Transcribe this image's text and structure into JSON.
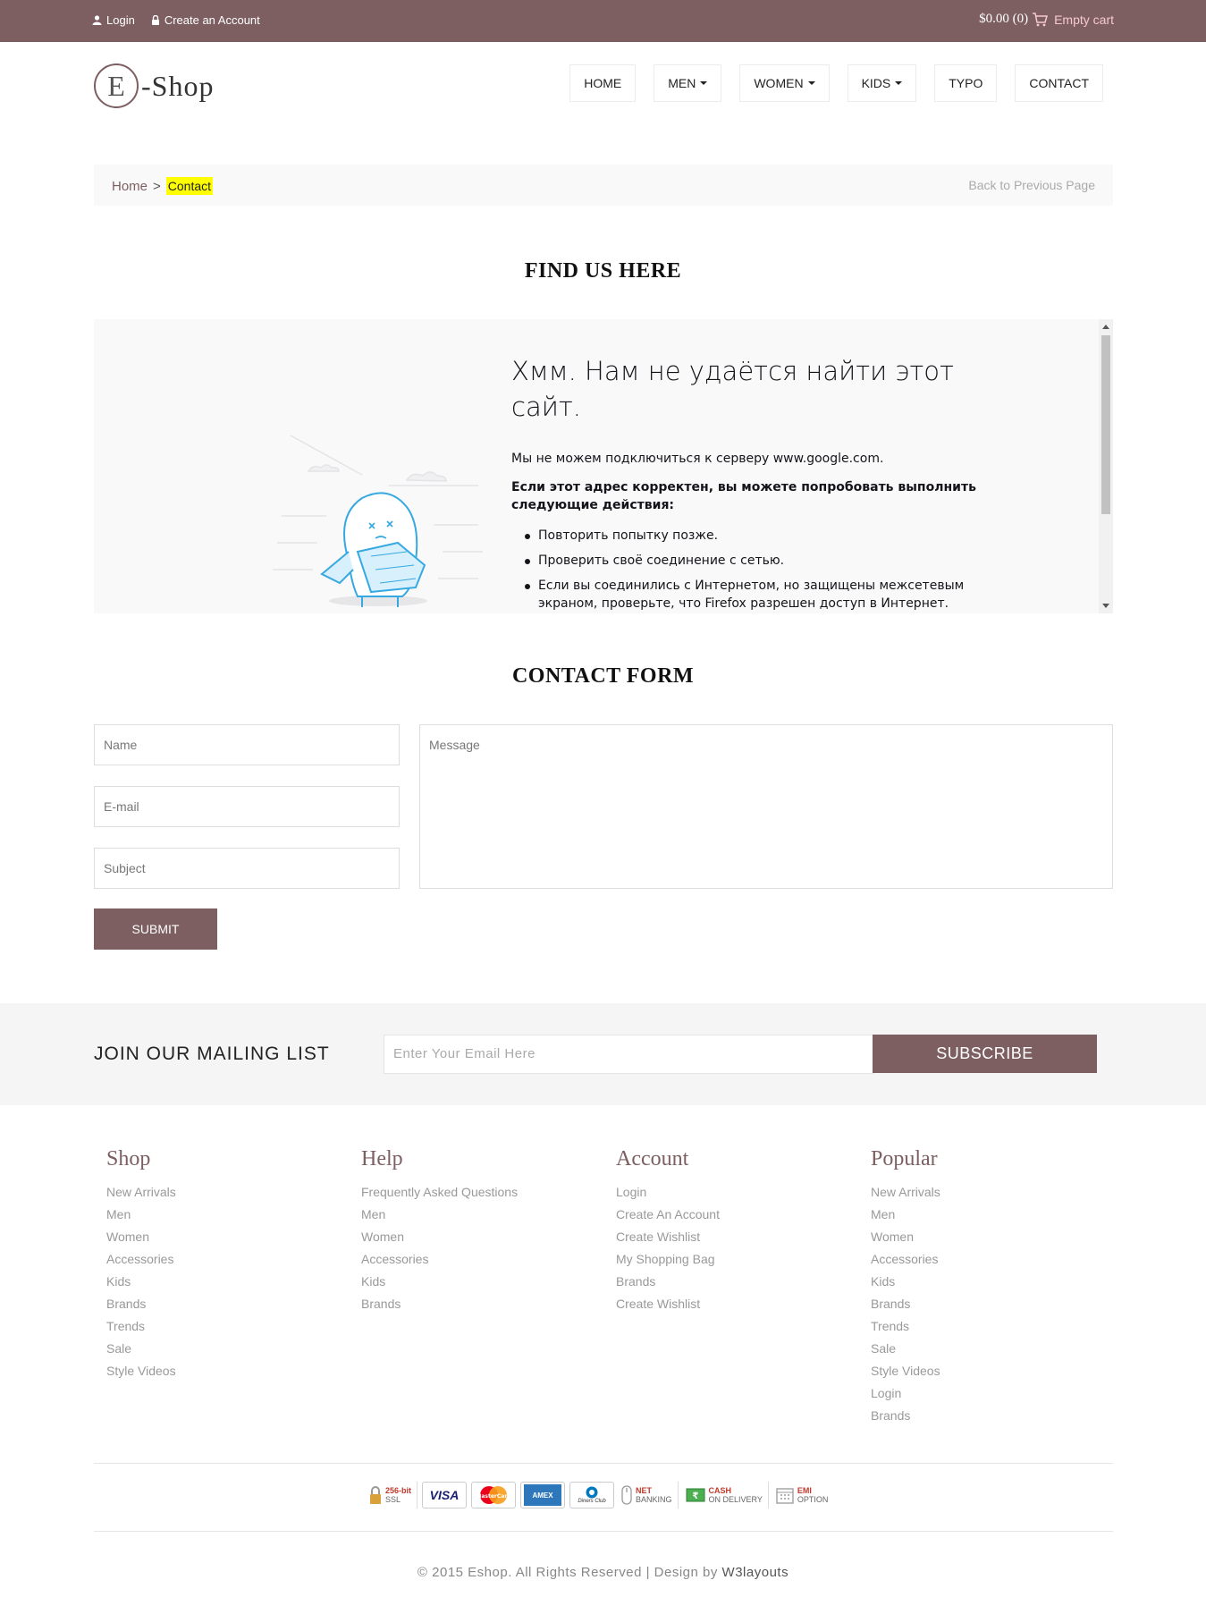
{
  "topbar": {
    "login": "Login",
    "create_account": "Create an Account",
    "cart_total": "$0.00 (0)",
    "cart_label": "Empty cart"
  },
  "header": {
    "logo_letter": "E",
    "logo_text": "-Shop",
    "nav": [
      {
        "label": "HOME",
        "dropdown": false
      },
      {
        "label": "MEN",
        "dropdown": true
      },
      {
        "label": "WOMEN",
        "dropdown": true
      },
      {
        "label": "KIDS",
        "dropdown": true
      },
      {
        "label": "TYPO",
        "dropdown": false
      },
      {
        "label": "CONTACT",
        "dropdown": false
      }
    ]
  },
  "breadcrumb": {
    "home": "Home",
    "separator": ">",
    "current": "Contact",
    "back": "Back to Previous Page"
  },
  "map_section": {
    "title": "FIND US HERE",
    "error": {
      "title": "Хмм. Нам не удаётся найти этот сайт.",
      "line1": "Мы не можем подключиться к серверу www.google.com.",
      "strong": "Если этот адрес корректен, вы можете попробовать выполнить следующие действия:",
      "items": [
        "Повторить попытку позже.",
        "Проверить своё соединение с сетью.",
        "Если вы соединились с Интернетом, но защищены межсетевым экраном, проверьте, что Firefox разрешен доступ в Интернет."
      ]
    }
  },
  "contact_form": {
    "title": "CONTACT FORM",
    "name_placeholder": "Name",
    "email_placeholder": "E-mail",
    "subject_placeholder": "Subject",
    "message_placeholder": "Message",
    "submit": "SUBMIT"
  },
  "newsletter": {
    "title": "JOIN OUR MAILING LIST",
    "email_placeholder": "Enter Your Email Here",
    "button": "SUBSCRIBE"
  },
  "footer": {
    "columns": [
      {
        "title": "Shop",
        "links": [
          "New Arrivals",
          "Men",
          "Women",
          "Accessories",
          "Kids",
          "Brands",
          "Trends",
          "Sale",
          "Style Videos"
        ]
      },
      {
        "title": "Help",
        "links": [
          "Frequently Asked Questions",
          "Men",
          "Women",
          "Accessories",
          "Kids",
          "Brands"
        ]
      },
      {
        "title": "Account",
        "links": [
          "Login",
          "Create An Account",
          "Create Wishlist",
          "My Shopping Bag",
          "Brands",
          "Create Wishlist"
        ]
      },
      {
        "title": "Popular",
        "links": [
          "New Arrivals",
          "Men",
          "Women",
          "Accessories",
          "Kids",
          "Brands",
          "Trends",
          "Sale",
          "Style Videos",
          "Login",
          "Brands"
        ]
      }
    ],
    "payments": {
      "ssl": "256-bit",
      "ssl_sub": "SSL",
      "visa": "VISA",
      "mastercard": "MasterCard",
      "amex": "AMEX",
      "diners": "Diners Club",
      "net": "NET",
      "net_sub": "BANKING",
      "cash": "CASH",
      "cash_sub": "ON DELIVERY",
      "emi": "EMI",
      "emi_sub": "OPTION"
    },
    "copyright": "© 2015 Eshop. All Rights Reserved | Design by",
    "designer": "W3layouts"
  },
  "colors": {
    "brand": "#7d5f61",
    "highlight": "#ffff00",
    "cart_link": "#f7c8cf"
  }
}
